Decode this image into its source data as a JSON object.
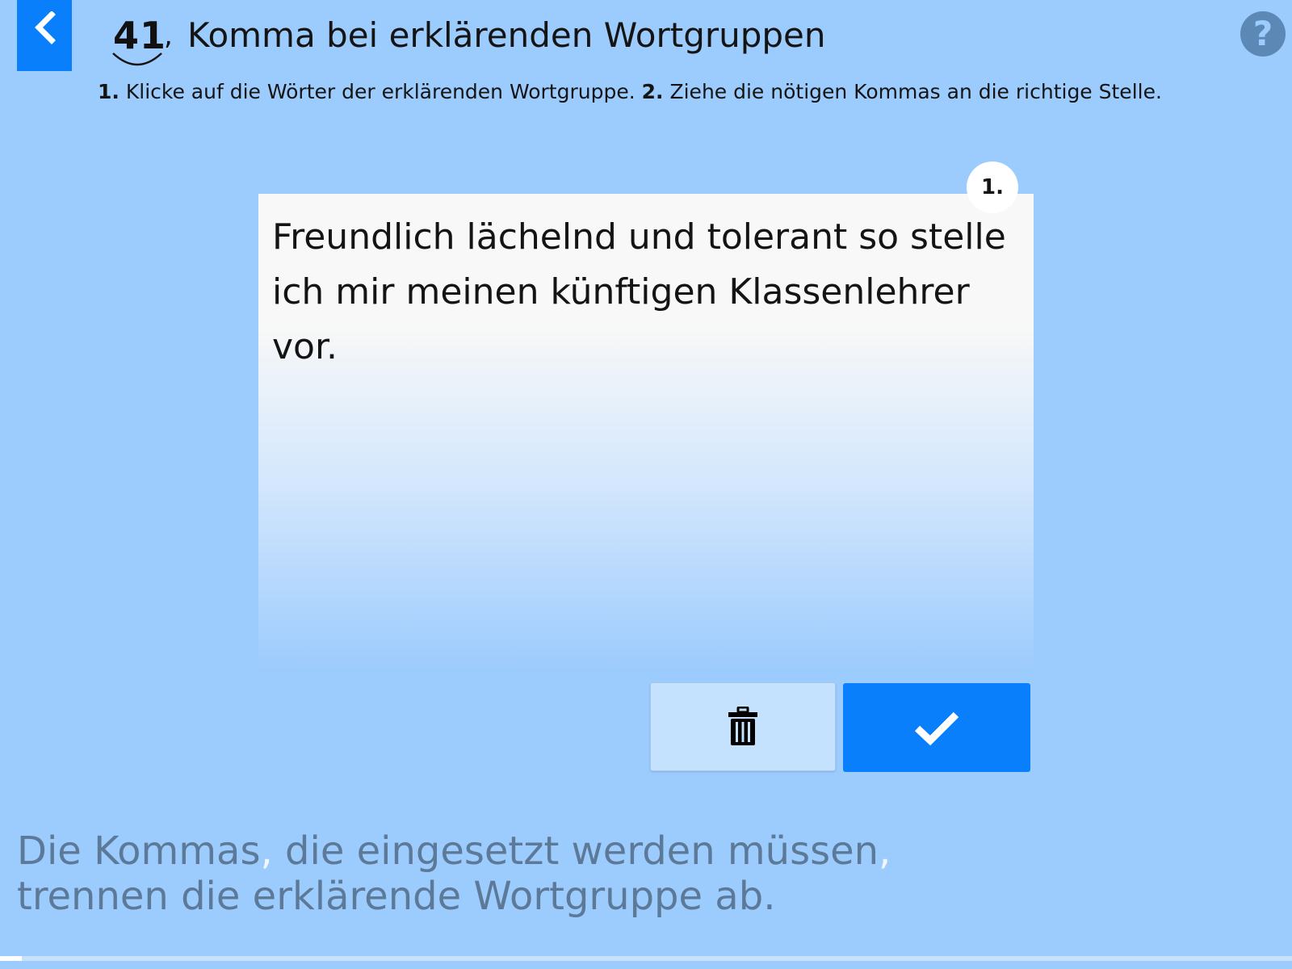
{
  "header": {
    "lesson_number": "41",
    "title_comma": ",",
    "title": "Komma bei erklärenden Wortgruppen",
    "help_label": "?"
  },
  "instructions": {
    "step1_number": "1.",
    "step1_text": "Klicke auf die Wörter der erklärenden Wortgruppe.",
    "step2_number": "2.",
    "step2_text": "Ziehe die nötigen Kommas an die richtige Stelle."
  },
  "exercise": {
    "step_badge": "1.",
    "sentence": "Freundlich lächelnd und tolerant so stelle ich mir meinen künftigen Klassenlehrer vor."
  },
  "hint": {
    "part1": "Die Kommas",
    "comma1": ",",
    "part2": " die eingesetzt werden müssen",
    "comma2": ",",
    "line2": "trennen die erklärende Wortgruppe ab."
  },
  "progress": {
    "fraction": 0.017
  },
  "colors": {
    "background": "#9ccbfd",
    "accent": "#0a7ffb",
    "hint_text": "#5d7998",
    "help_icon": "#5c88b5"
  },
  "icons": {
    "back": "chevron-left-icon",
    "help": "question-mark-icon",
    "delete": "trash-icon",
    "check": "checkmark-icon"
  }
}
